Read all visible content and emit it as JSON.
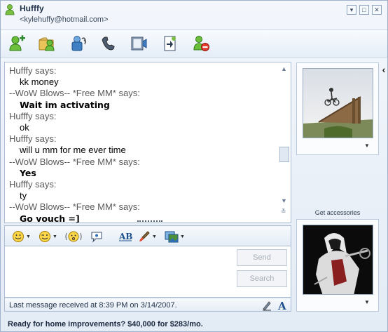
{
  "window": {
    "contact_name": "Hufffy",
    "contact_email": "<kylehuffy@hotmail.com>",
    "buttons": {
      "minimize": "▾",
      "maximize": "□",
      "close": "✕"
    }
  },
  "toolbar": {
    "items": [
      "invite-contact-icon",
      "send-files-icon",
      "webcam-icon",
      "call-icon",
      "video-clip-icon",
      "activities-icon",
      "block-icon"
    ]
  },
  "conversation": {
    "messages": [
      {
        "sender": "Hufffy says:",
        "text": "kk money",
        "bold": false
      },
      {
        "sender": "--WoW Blows-- *Free MM* says:",
        "text": "Wait im activating",
        "bold": true
      },
      {
        "sender": "Hufffy says:",
        "text": "ok",
        "bold": false
      },
      {
        "sender": "Hufffy says:",
        "text": "will u mm for me ever time",
        "bold": false
      },
      {
        "sender": "--WoW Blows-- *Free MM* says:",
        "text": "Yes",
        "bold": true
      },
      {
        "sender": "Hufffy says:",
        "text": "ty",
        "bold": false
      },
      {
        "sender": "--WoW Blows-- *Free MM* says:",
        "text": "Go vouch =]",
        "bold": true
      }
    ]
  },
  "compose": {
    "input_value": "",
    "send_label": "Send",
    "search_label": "Search"
  },
  "status": {
    "last_message": "Last message received at 8:39 PM on 3/14/2007."
  },
  "ad": {
    "text": "Ready for home improvements?  $40,000 for $283/mo."
  },
  "sidebar": {
    "accessories_label": "Get accessories"
  }
}
